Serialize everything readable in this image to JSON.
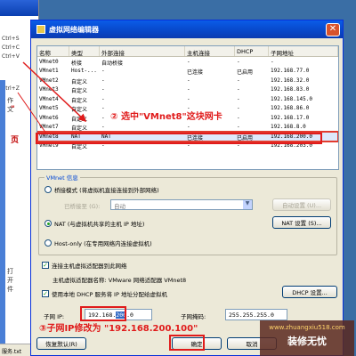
{
  "background_window": {
    "menu_items": [
      "Ctrl+S",
      "Ctrl+C",
      "Ctrl+V",
      "Ctrl+Z",
      "Ctrl+F",
      "Ctrl+P"
    ],
    "side_texts": [
      "作",
      "文",
      "打",
      "开",
      "件"
    ],
    "red_marks": [
      "\"",
      "页"
    ],
    "status_text": "服务.txt"
  },
  "dialog": {
    "title": "虚拟网络编辑器",
    "close_glyph": "✕",
    "table": {
      "headers": [
        "名称",
        "类型",
        "外部连接",
        "主机连接",
        "DHCP",
        "子网地址"
      ],
      "rows": [
        [
          "VMnet0",
          "桥接",
          "自动桥接",
          "-",
          "-",
          "-"
        ],
        [
          "VMnet1",
          "Host-...",
          "-",
          "已连接",
          "已启用",
          "192.168.77.0"
        ],
        [
          "VMnet2",
          "自定义",
          "-",
          "-",
          "-",
          "192.168.32.0"
        ],
        [
          "VMnet3",
          "自定义",
          "-",
          "-",
          "-",
          "192.168.83.0"
        ],
        [
          "VMnet4",
          "自定义",
          "-",
          "-",
          "-",
          "192.168.145.0"
        ],
        [
          "VMnet5",
          "自定义",
          "-",
          "-",
          "-",
          "192.168.86.0"
        ],
        [
          "VMnet6",
          "自定义",
          "-",
          "-",
          "-",
          "192.168.17.0"
        ],
        [
          "VMnet7",
          "自定义",
          "-",
          "-",
          "-",
          "192.168.8.0"
        ],
        [
          "VMnet8",
          "NAT",
          "NAT",
          "已连接",
          "已启用",
          "192.168.200.0"
        ],
        [
          "VMnet9",
          "自定义",
          "-",
          "-",
          "-",
          "192.168.203.0"
        ]
      ],
      "selected_index": 8
    },
    "info_group_title": "VMnet 信息",
    "bridge_radio": "桥接模式 (将虚拟机直接连接到外部网络)",
    "bridged_to_label": "已桥接至 (G):",
    "bridged_to_value": "自动",
    "auto_settings_btn": "自动设置 (U)...",
    "nat_radio": "NAT (与虚拟机共享的主机 IP 地址)",
    "nat_settings_btn": "NAT 设置 (S)...",
    "hostonly_radio": "Host-only (在专用网络内连接虚拟机)",
    "connect_adapter_check": "连接主机虚拟适配器到此网络",
    "adapter_name_label": "主机虚拟适配器名称: VMware 网络适配器 VMnet8",
    "dhcp_check": "使用本地 DHCP 服务将 IP 地址分配给虚拟机",
    "dhcp_settings_btn": "DHCP 设置...",
    "subnet_ip_label": "子网 IP:",
    "subnet_ip_prefix": "192.168.",
    "subnet_ip_highlight": "200",
    "subnet_ip_suffix": ".0",
    "subnet_mask_label": "子网掩码:",
    "subnet_mask_value": "255.255.255.0",
    "restore_defaults_btn": "恢复默认(R)",
    "ok_btn": "确定",
    "cancel_btn": "取消"
  },
  "annotations": {
    "step2": "② 选中\"VMnet8\"这块网卡",
    "step3": "③子网IP修改为 \"192.168.200.100\""
  },
  "watermark": {
    "url": "www.zhuangxiu518.com",
    "brand": "装修无忧"
  },
  "colors": {
    "annotation_red": "#e01b1b",
    "titlebar_blue": "#0a5ce8",
    "dialog_bg": "#ece9d8"
  }
}
